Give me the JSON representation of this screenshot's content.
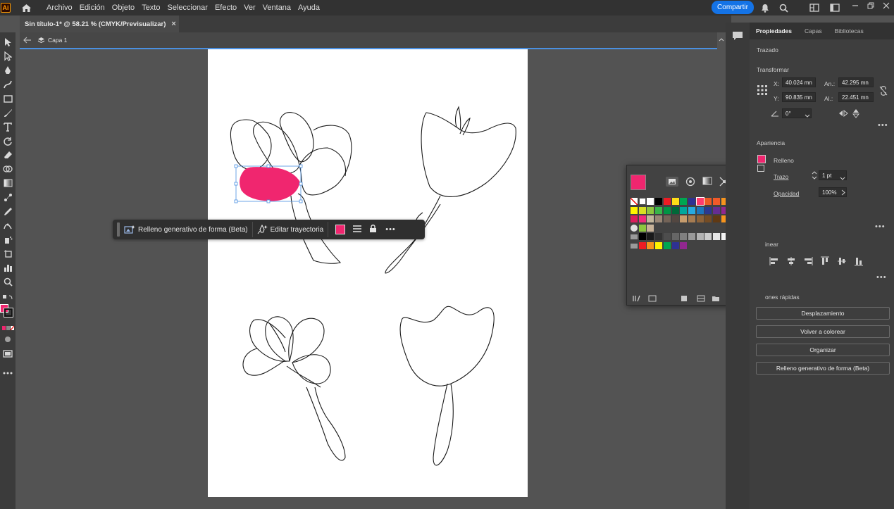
{
  "menu": {
    "logo": "Ai",
    "items": [
      "Archivo",
      "Edición",
      "Objeto",
      "Texto",
      "Seleccionar",
      "Efecto",
      "Ver",
      "Ventana",
      "Ayuda"
    ],
    "share_label": "Compartir"
  },
  "document": {
    "tab_title": "Sin título-1* @ 58.21 % (CMYK/Previsualizar)",
    "tab_close": "×",
    "layer": "Capa 1"
  },
  "taskbar": {
    "generative_fill": "Relleno generativo de forma (Beta)",
    "edit_path": "Editar trayectoria",
    "more": "•••"
  },
  "colors": {
    "fill": "#f0266f",
    "accent": "#1473e6",
    "selection": "#4a90e2"
  },
  "properties": {
    "tabs": [
      "Propiedades",
      "Capas",
      "Bibliotecas"
    ],
    "object_type": "Trazado",
    "transform": {
      "heading": "Transformar",
      "x_label": "X:",
      "x_value": "40.024 mn",
      "y_label": "Y:",
      "y_value": "90.835 mn",
      "w_label": "An.:",
      "w_value": "42.295 mn",
      "h_label": "Al.:",
      "h_value": "22.451 mn",
      "angle_value": "0°"
    },
    "appearance": {
      "heading": "Apariencia",
      "fill_label": "Relleno",
      "stroke_label": "Trazo",
      "stroke_value": "1 pt",
      "opacity_label": "Opacidad",
      "opacity_value": "100%"
    },
    "align_heading": "inear",
    "quick_actions": {
      "heading": "ones rápidas",
      "buttons": [
        "Desplazamiento",
        "Volver a colorear",
        "Organizar",
        "Relleno generativo de forma (Beta)"
      ]
    }
  }
}
